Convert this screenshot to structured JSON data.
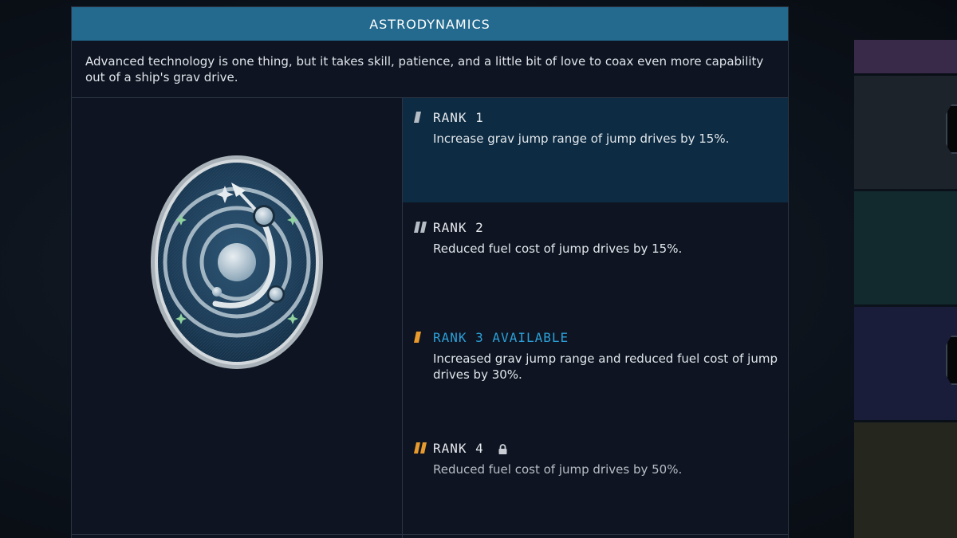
{
  "panel": {
    "title": "ASTRODYNAMICS",
    "description": "Advanced technology is one thing, but it takes skill, patience, and a little bit of love to coax even more capability out of a ship's grav drive.",
    "badge_icon": "orbit-patch-icon"
  },
  "ranks": [
    {
      "title": "RANK 1",
      "description": "Increase grav jump range of jump drives by 15%.",
      "state": "active"
    },
    {
      "title": "RANK 2",
      "description": "Reduced fuel cost of jump drives by 15%.",
      "state": "unlocked"
    },
    {
      "title": "RANK 3 AVAILABLE",
      "description": "Increased grav jump range and reduced fuel cost of jump drives by 30%.",
      "state": "available"
    },
    {
      "title": "RANK 4",
      "description": "Reduced fuel cost of jump drives by 50%.",
      "state": "locked",
      "icon": "lock-icon"
    }
  ],
  "colors": {
    "header": "#236a8e",
    "active_rank_bg": "#0d2b42",
    "available_text": "#2ba0d8",
    "rank_marker_orange": "#e89a2c",
    "rank_marker_gray": "#b5bcc4",
    "side_tabs": [
      "#3a2a4a",
      "#1c232b",
      "#122a2e",
      "#1a1d3a",
      "#25271f"
    ]
  }
}
